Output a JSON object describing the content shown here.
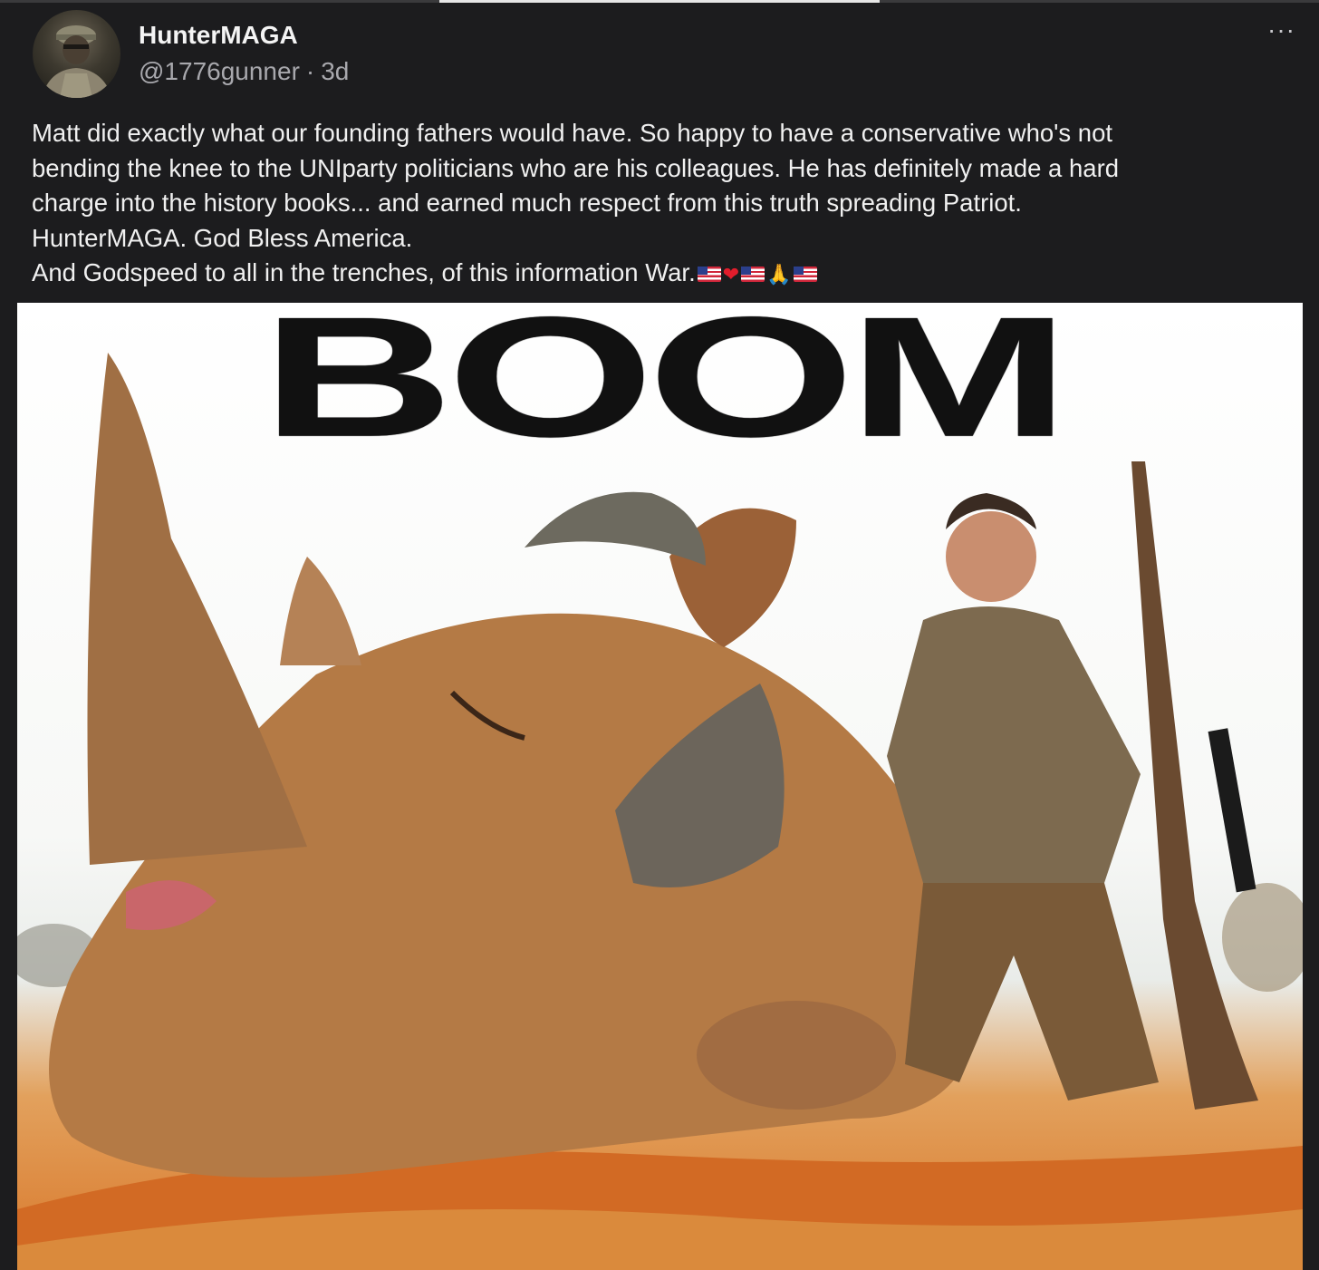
{
  "tab_indicator": {
    "active_index": 1,
    "count": 3
  },
  "post": {
    "author_name": "HunterMAGA",
    "handle": "@1776gunner",
    "separator": "·",
    "age": "3d",
    "more_icon": "more-horizontal-icon",
    "lines": [
      "Matt did  exactly what our founding fathers would have. So happy to have a conservative who's not",
      "bending  the knee to the UNIparty politicians who are his colleagues. He has definitely made a hard",
      "charge into the history books... and earned much respect from this truth spreading Patriot.",
      "HunterMAGA. God Bless America."
    ],
    "last_line_text": "And Godspeed to all in the trenches, of this information War.",
    "last_line_emojis": [
      "flag-us",
      "red-heart",
      "flag-us",
      "folded-hands",
      "flag-us"
    ]
  },
  "media": {
    "headline": "BOOM",
    "description_icon": "meme-image"
  },
  "colors": {
    "background": "#1c1c1e",
    "text": "#f0f0f0",
    "muted": "#a8a8ad"
  }
}
